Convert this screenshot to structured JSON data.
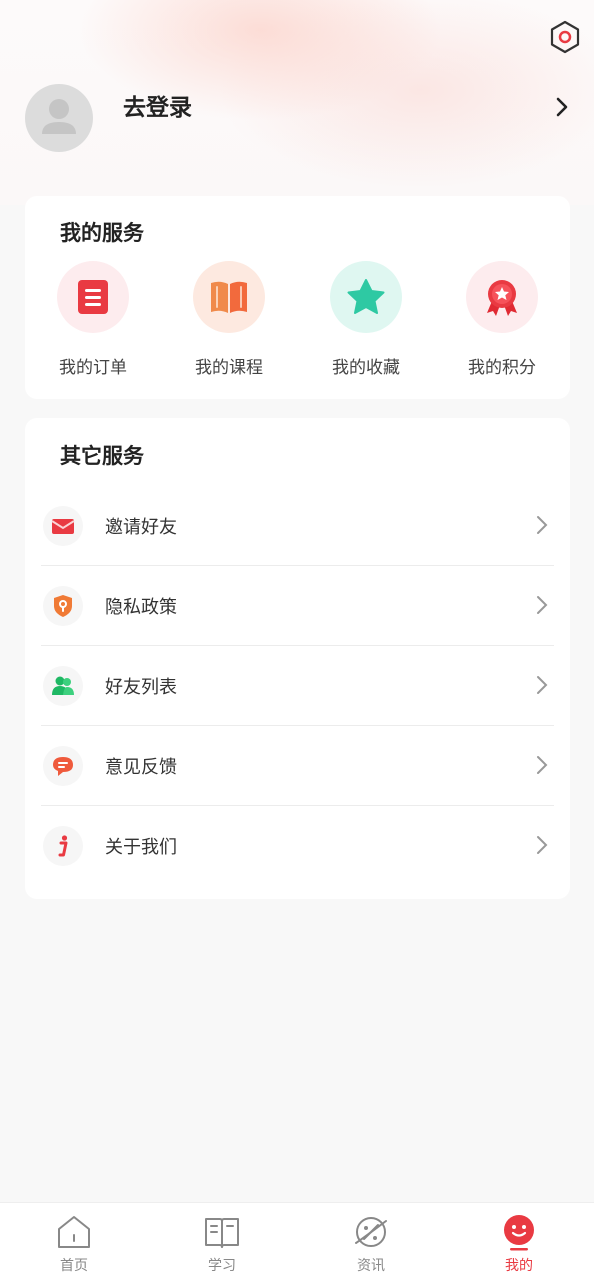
{
  "profile": {
    "login_label": "去登录"
  },
  "services": {
    "title": "我的服务",
    "items": [
      {
        "label": "我的订单",
        "icon": "order-list-icon"
      },
      {
        "label": "我的课程",
        "icon": "book-icon"
      },
      {
        "label": "我的收藏",
        "icon": "star-icon"
      },
      {
        "label": "我的积分",
        "icon": "medal-icon"
      }
    ]
  },
  "other": {
    "title": "其它服务",
    "items": [
      {
        "label": "邀请好友",
        "icon": "envelope-icon"
      },
      {
        "label": "隐私政策",
        "icon": "shield-icon"
      },
      {
        "label": "好友列表",
        "icon": "friends-icon"
      },
      {
        "label": "意见反馈",
        "icon": "feedback-icon"
      },
      {
        "label": "关于我们",
        "icon": "info-icon"
      }
    ]
  },
  "tabbar": {
    "items": [
      {
        "label": "首页",
        "icon": "home-icon"
      },
      {
        "label": "学习",
        "icon": "study-icon"
      },
      {
        "label": "资讯",
        "icon": "news-icon"
      },
      {
        "label": "我的",
        "icon": "profile-icon",
        "active": true
      }
    ]
  },
  "colors": {
    "accent": "#e93a42",
    "text": "#222222",
    "muted": "#888888"
  }
}
